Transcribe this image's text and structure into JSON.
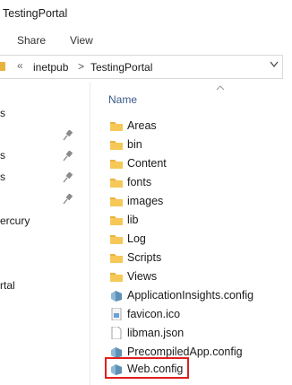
{
  "window": {
    "title": "TestingPortal"
  },
  "ribbon": {
    "tabs": [
      "Share",
      "View"
    ]
  },
  "address": {
    "overflow": "«",
    "crumbs": [
      "inetpub",
      "TestingPortal"
    ],
    "separator": ">"
  },
  "nav_pane": {
    "items": [
      "s",
      "s",
      "s",
      "ercury",
      "rtal"
    ]
  },
  "list": {
    "header": "Name",
    "items": [
      {
        "name": "Areas",
        "icon": "folder-icon"
      },
      {
        "name": "bin",
        "icon": "folder-icon"
      },
      {
        "name": "Content",
        "icon": "folder-icon"
      },
      {
        "name": "fonts",
        "icon": "folder-icon"
      },
      {
        "name": "images",
        "icon": "folder-icon"
      },
      {
        "name": "lib",
        "icon": "folder-icon"
      },
      {
        "name": "Log",
        "icon": "folder-icon"
      },
      {
        "name": "Scripts",
        "icon": "folder-icon"
      },
      {
        "name": "Views",
        "icon": "folder-icon"
      },
      {
        "name": "ApplicationInsights.config",
        "icon": "config-file-icon"
      },
      {
        "name": "favicon.ico",
        "icon": "image-file-icon"
      },
      {
        "name": "libman.json",
        "icon": "generic-file-icon"
      },
      {
        "name": "PrecompiledApp.config",
        "icon": "config-file-icon"
      },
      {
        "name": "Web.config",
        "icon": "config-file-icon"
      }
    ],
    "highlighted": "Web.config"
  },
  "colors": {
    "folder": "#e8b33c",
    "highlight": "#e02020",
    "header_text": "#3b5a8c"
  }
}
